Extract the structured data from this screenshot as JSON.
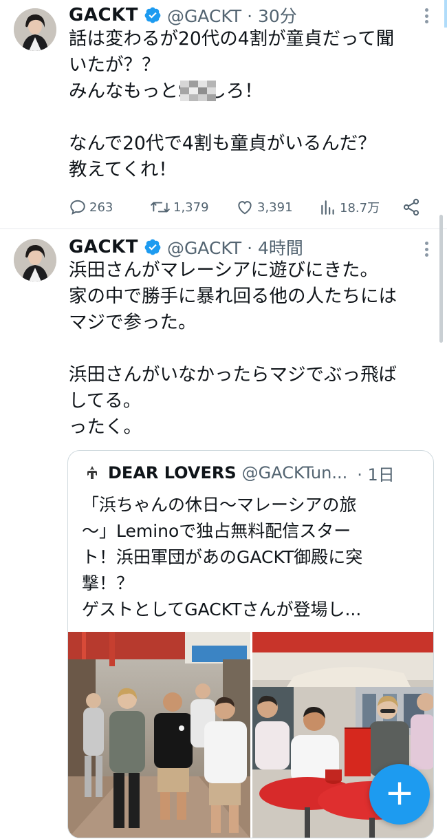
{
  "colors": {
    "accent": "#1d9bf0",
    "secondary_text": "#536471",
    "primary_text": "#0f1419"
  },
  "tweets": [
    {
      "display_name": "GACKT",
      "handle_time": "@GACKT · 30分",
      "lines": [
        "話は変わるが20代の4割が童貞だって聞",
        "いたが？？",
        "みんなもっとS  Xしろ！",
        "",
        "なんで20代で4割も童貞がいるんだ？",
        "教えてくれ！"
      ],
      "actions": {
        "replies": "263",
        "retweets": "1,379",
        "likes": "3,391",
        "views": "18.7万"
      }
    },
    {
      "display_name": "GACKT",
      "handle_time": "@GACKT · 4時間",
      "lines": [
        "浜田さんがマレーシアに遊びにきた。",
        "家の中で勝手に暴れ回る他の人たちには",
        "マジで参った。",
        "",
        "浜田さんがいなかったらマジでぶっ飛ば",
        "してる。",
        "ったく。"
      ],
      "quote": {
        "display_name": "DEAR LOVERS",
        "handle": "@GACKTun...",
        "time": "· 1日",
        "lines": [
          "「浜ちゃんの休日〜マレーシアの旅",
          "〜」Leminoで独占無料配信スター",
          "ト！浜田軍団があのGACKT御殿に突",
          "撃！？",
          "ゲストとしてGACKTさんが登場し..."
        ]
      }
    }
  ],
  "fab": {
    "label": "+"
  },
  "icons": [
    "verified-badge-icon",
    "more-options-icon",
    "reply-icon",
    "retweet-icon",
    "like-icon",
    "views-icon",
    "share-icon",
    "compose-icon"
  ]
}
